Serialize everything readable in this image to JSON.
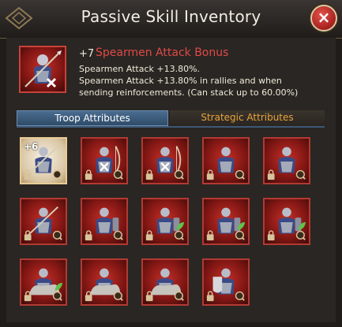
{
  "window": {
    "title": "Passive Skill Inventory",
    "close_label": "×"
  },
  "skill": {
    "level": "+7",
    "name": "Spearmen Attack Bonus",
    "line1": "Spearmen Attack +13.80%.",
    "line2": "Spearmen Attack +13.80% in rallies and when",
    "line3": "sending reinforcements. (Can stack up to 60.00%)",
    "icon": "spearman-icon"
  },
  "tabs": [
    {
      "label": "Troop Attributes",
      "active": true
    },
    {
      "label": "Strategic Attributes",
      "active": false
    }
  ],
  "items": [
    {
      "level": "+6",
      "icon": "spearman-icon",
      "badges": [
        "lock-icon",
        "magnifier-icon"
      ],
      "selected": true
    },
    {
      "level": "",
      "icon": "archer-icon",
      "badges": [
        "lock-icon",
        "cross-icon",
        "magnifier-icon"
      ],
      "selected": false
    },
    {
      "level": "",
      "icon": "archer-icon",
      "badges": [
        "lock-icon",
        "cross-icon",
        "magnifier-icon"
      ],
      "selected": false
    },
    {
      "level": "",
      "icon": "infantry-icon",
      "badges": [
        "lock-icon",
        "magnifier-icon"
      ],
      "selected": false
    },
    {
      "level": "",
      "icon": "infantry-icon",
      "badges": [
        "lock-icon",
        "magnifier-icon"
      ],
      "selected": false
    },
    {
      "level": "",
      "icon": "spearman-icon",
      "badges": [
        "lock-icon",
        "magnifier-icon"
      ],
      "selected": false
    },
    {
      "level": "",
      "icon": "knight-icon",
      "badges": [
        "lock-icon",
        "magnifier-icon"
      ],
      "selected": false
    },
    {
      "level": "",
      "icon": "knight-icon",
      "badges": [
        "lock-icon",
        "leaf-icon",
        "magnifier-icon"
      ],
      "selected": false
    },
    {
      "level": "",
      "icon": "knight-icon",
      "badges": [
        "lock-icon",
        "leaf-icon",
        "magnifier-icon"
      ],
      "selected": false
    },
    {
      "level": "",
      "icon": "knight-icon",
      "badges": [
        "lock-icon",
        "leaf-icon",
        "magnifier-icon"
      ],
      "selected": false
    },
    {
      "level": "",
      "icon": "cavalry-icon",
      "badges": [
        "lock-icon",
        "leaf-icon",
        "magnifier-icon"
      ],
      "selected": false
    },
    {
      "level": "",
      "icon": "cavalry-icon",
      "badges": [
        "lock-icon",
        "magnifier-icon"
      ],
      "selected": false
    },
    {
      "level": "",
      "icon": "cavalry-icon",
      "badges": [
        "lock-icon",
        "magnifier-icon"
      ],
      "selected": false
    },
    {
      "level": "",
      "icon": "shield-knight-icon",
      "badges": [
        "lock-icon",
        "magnifier-icon"
      ],
      "selected": false
    }
  ],
  "colors": {
    "accent_red": "#e04a48",
    "strategic_tab": "#e8a43a",
    "active_tab": "#3d5877"
  }
}
